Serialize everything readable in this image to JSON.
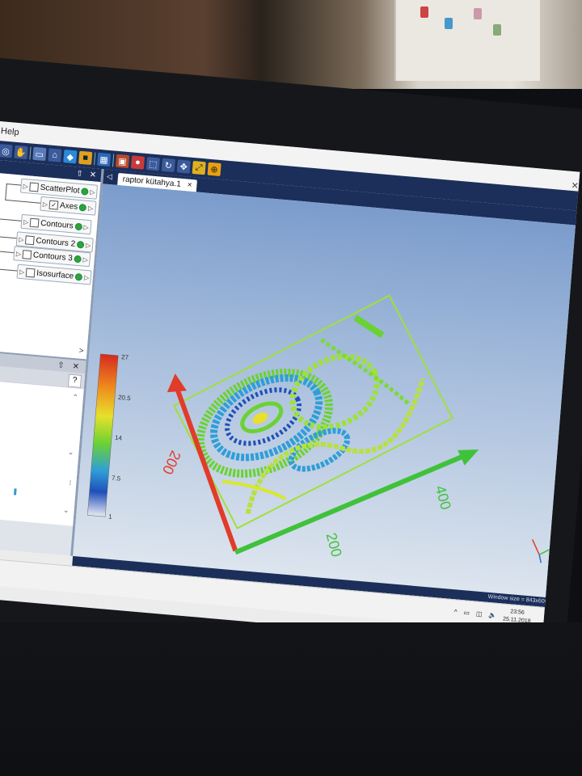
{
  "menu": {
    "help_label": "Help"
  },
  "toolbar": {
    "icons": [
      "zoom-icon",
      "hand-icon",
      "separator",
      "window-icon",
      "home-icon",
      "cube-icon",
      "box-icon",
      "separator",
      "grid-icon",
      "separator",
      "camera-icon",
      "light-icon",
      "select-icon",
      "rotate-icon",
      "pan-icon",
      "fit-icon",
      "zoom-box-icon"
    ]
  },
  "panel": {
    "pin": "⇧",
    "close": "✕"
  },
  "pipeline": {
    "nodes": [
      {
        "label": "ScatterPlot",
        "checked": false
      },
      {
        "label": "Axes",
        "checked": true
      },
      {
        "label": "Contours",
        "checked": false
      },
      {
        "label": "Contours 2",
        "checked": false
      },
      {
        "label": "Contours 3",
        "checked": false
      },
      {
        "label": "Isosurface",
        "checked": false
      }
    ],
    "scroll_glyph": ">"
  },
  "properties": {
    "pin": "⇧",
    "close": "✕",
    "help": "?"
  },
  "tab": {
    "title": "raptor kütahya.1",
    "close": "×"
  },
  "colorbar": {
    "ticks": [
      "27",
      "20.5",
      "14",
      "7.5",
      "1"
    ],
    "colors": [
      "#d62a1f",
      "#ee8a1d",
      "#e8e02a",
      "#6bd233",
      "#2f9ed8",
      "#1f4fb8",
      "#e8e8f3"
    ]
  },
  "axes": {
    "red_label": "200",
    "green_labels": [
      "200",
      "400"
    ],
    "colors": {
      "red": "#e23b2a",
      "green": "#3fc23a",
      "box": "#9fe03a"
    }
  },
  "status": {
    "window_size": "Window size = 843x600"
  },
  "taskbar": {
    "time": "23:56",
    "date": "25.11.2018",
    "tray_icons": [
      "chevron-up-icon",
      "battery-icon",
      "network-icon",
      "volume-icon"
    ]
  }
}
